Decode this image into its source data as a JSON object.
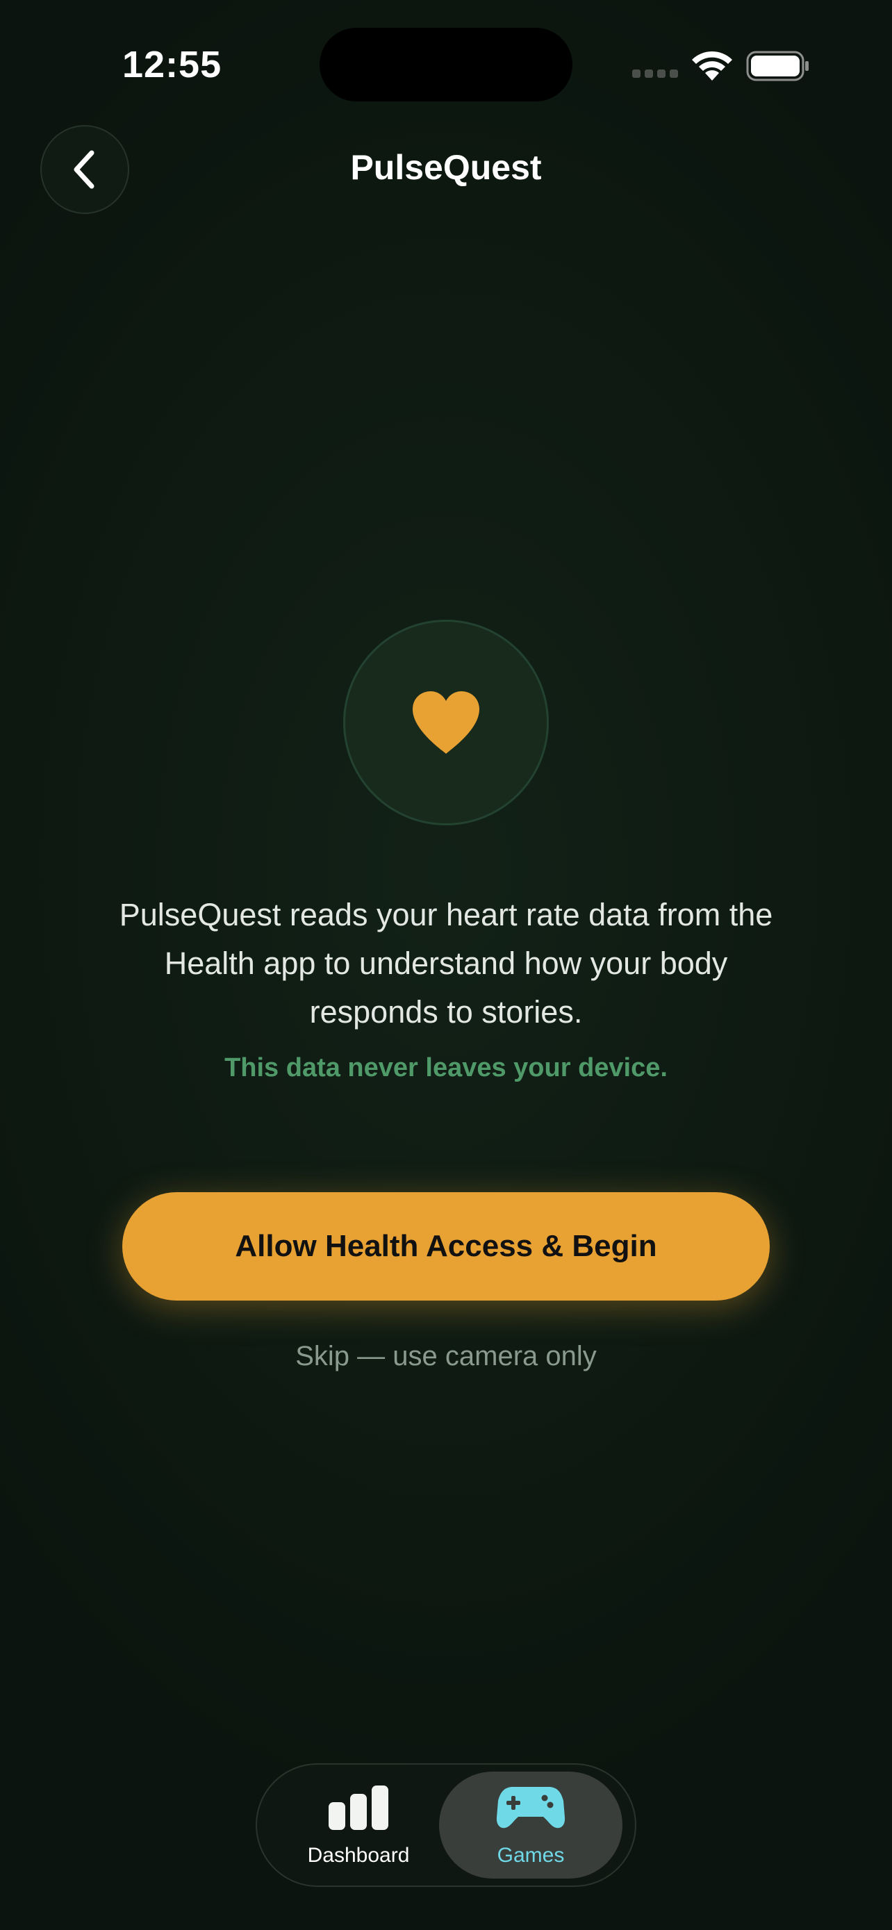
{
  "status_bar": {
    "time": "12:55"
  },
  "nav": {
    "title": "PulseQuest"
  },
  "main": {
    "description": "PulseQuest reads your heart rate data from the Health app to understand how your body responds to stories.",
    "privacy_note": "This data never leaves your device.",
    "allow_button": "Allow Health Access & Begin",
    "skip_link": "Skip — use camera only"
  },
  "tab_bar": {
    "tabs": [
      {
        "label": "Dashboard",
        "icon": "bar-chart-icon",
        "selected": false
      },
      {
        "label": "Games",
        "icon": "gamepad-icon",
        "selected": true
      }
    ]
  },
  "colors": {
    "accent": "#e8a233",
    "privacy_green": "#4f9a68",
    "tab_selected": "#6fd9e8",
    "background": "#0c160f"
  }
}
